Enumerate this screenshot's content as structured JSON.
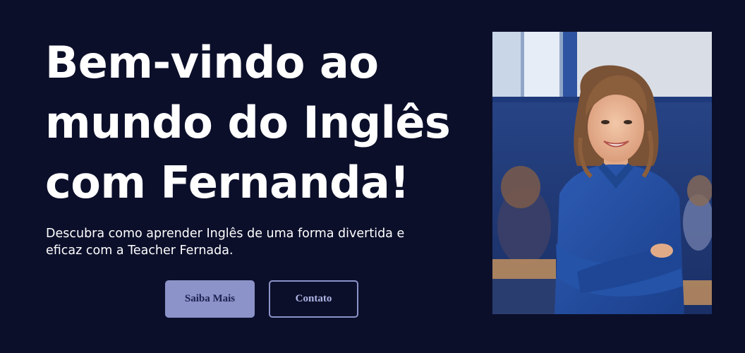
{
  "hero": {
    "headline_lines": [
      "Bem-vindo ao",
      "mundo do Inglês",
      "com Fernanda!"
    ],
    "subtitle_lines": [
      "Descubra como aprender Inglês de uma forma divertida e",
      "eficaz com a Teacher Fernada."
    ],
    "primary_button_label": "Saiba Mais",
    "secondary_button_label": "Contato"
  },
  "colors": {
    "background": "#0b0f2a",
    "primary_button": "#8b93c9",
    "text": "#ffffff"
  },
  "image": {
    "subject": "smiling teacher with arms crossed in a classroom"
  }
}
